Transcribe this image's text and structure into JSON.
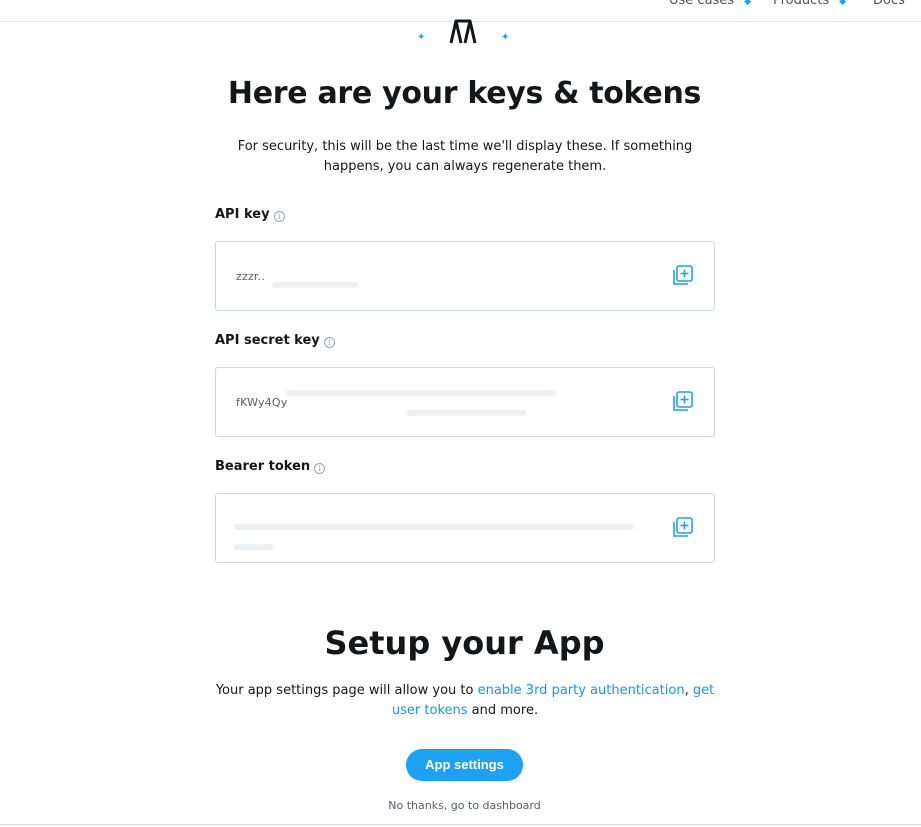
{
  "nav": {
    "items": [
      {
        "label": "Use cases"
      },
      {
        "label": "Products"
      },
      {
        "label": "Docs"
      }
    ]
  },
  "page": {
    "title": "Here are your keys & tokens",
    "subtitle": "For security, this will be the last time we'll display these. If something happens, you can always regenerate them."
  },
  "fields": [
    {
      "label": "API key",
      "value": "zzzr..",
      "icon": "copy-icon"
    },
    {
      "label": "API secret key",
      "value": "fKWy4Qy",
      "icon": "copy-icon"
    },
    {
      "label": "Bearer token",
      "value": "",
      "icon": "copy-icon"
    }
  ],
  "setup": {
    "title": "Setup your App",
    "text_before": "Your app settings page will allow you to ",
    "link_auth": "enable 3rd party authentication",
    "separator": ", ",
    "link_tokens": "get user tokens",
    "text_after": " and more.",
    "button_label": "App settings",
    "dashboard_link": "No thanks, go to dashboard"
  },
  "colors": {
    "accent": "#1da1f2",
    "link": "#1b95e0",
    "text": "#14171a",
    "border": "#ccd6dd"
  }
}
